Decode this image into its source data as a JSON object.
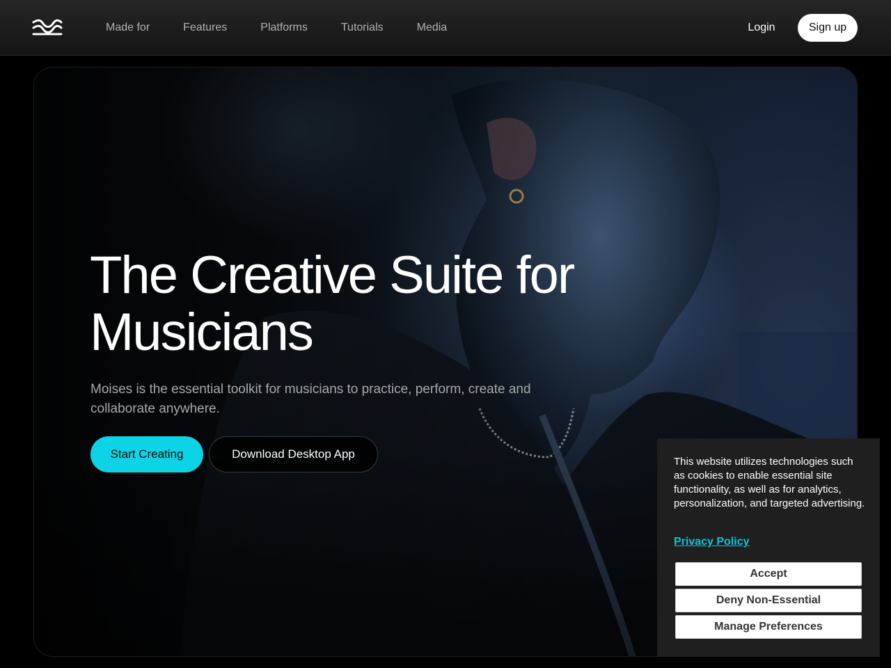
{
  "header": {
    "logo": "moises-wave-logo",
    "nav_items": [
      {
        "label": "Made for"
      },
      {
        "label": "Features"
      },
      {
        "label": "Platforms"
      },
      {
        "label": "Tutorials"
      },
      {
        "label": "Media"
      }
    ],
    "login_label": "Login",
    "signup_label": "Sign up"
  },
  "hero": {
    "title": "The Creative Suite for Musicians",
    "subtitle": "Moises is the essential toolkit for musicians to practice, perform, create and collaborate anywhere.",
    "primary_cta": "Start Creating",
    "secondary_cta": "Download Desktop App",
    "background": "musician-portrait-photo"
  },
  "cookie_banner": {
    "text": "This website utilizes technologies such as cookies to enable essential site functionality, as well as for analytics, personalization, and targeted advertising.",
    "privacy_link": "Privacy Policy",
    "accept_label": "Accept",
    "deny_label": "Deny Non-Essential",
    "manage_label": "Manage Preferences"
  },
  "colors": {
    "accent": "#0dd3e6",
    "link": "#13c4d6",
    "page_bg": "#000000",
    "nav_text": "#b3b3b3"
  }
}
